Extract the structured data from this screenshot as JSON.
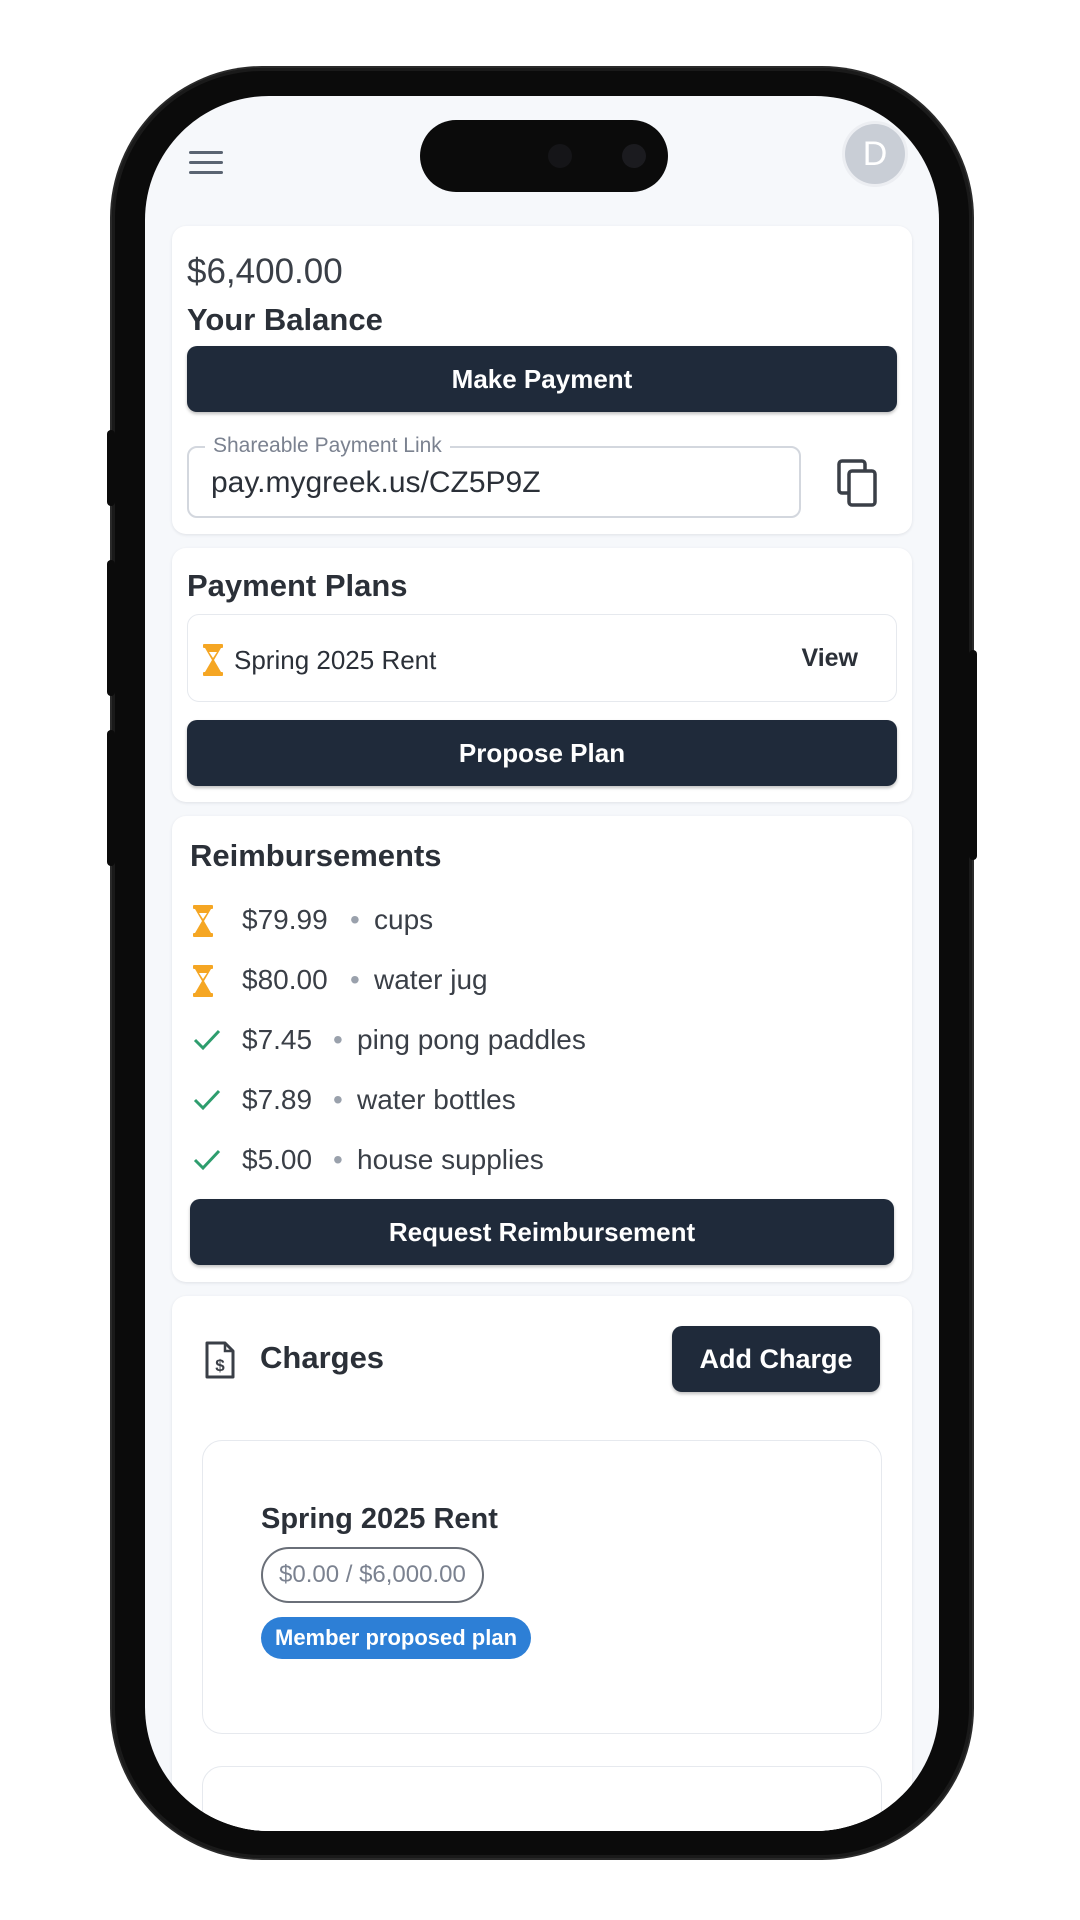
{
  "header": {
    "avatar_initial": "D"
  },
  "balance": {
    "amount": "$6,400.00",
    "label": "Your Balance",
    "make_payment_label": "Make Payment",
    "link_label": "Shareable Payment Link",
    "link_value": "pay.mygreek.us/CZ5P9Z"
  },
  "payment_plans": {
    "title": "Payment Plans",
    "items": [
      {
        "name": "Spring 2025 Rent",
        "status_icon": "hourglass-icon",
        "action": "View"
      }
    ],
    "propose_label": "Propose Plan"
  },
  "reimbursements": {
    "title": "Reimbursements",
    "items": [
      {
        "status": "pending",
        "status_icon": "hourglass-icon",
        "amount": "$79.99",
        "description": "cups"
      },
      {
        "status": "pending",
        "status_icon": "hourglass-icon",
        "amount": "$80.00",
        "description": "water jug"
      },
      {
        "status": "approved",
        "status_icon": "check-icon",
        "amount": "$7.45",
        "description": "ping pong paddles"
      },
      {
        "status": "approved",
        "status_icon": "check-icon",
        "amount": "$7.89",
        "description": "water bottles"
      },
      {
        "status": "approved",
        "status_icon": "check-icon",
        "amount": "$5.00",
        "description": "house supplies"
      }
    ],
    "separator": "•",
    "request_label": "Request Reimbursement"
  },
  "charges": {
    "title": "Charges",
    "add_label": "Add Charge",
    "items": [
      {
        "name": "Spring 2025 Rent",
        "amount": "$0.00 / $6,000.00",
        "badge": "Member proposed plan"
      }
    ]
  },
  "colors": {
    "primary_dark": "#1f2a3a",
    "pending": "#f5a623",
    "approved": "#2e9d6e",
    "badge_blue": "#2d7fd6"
  }
}
